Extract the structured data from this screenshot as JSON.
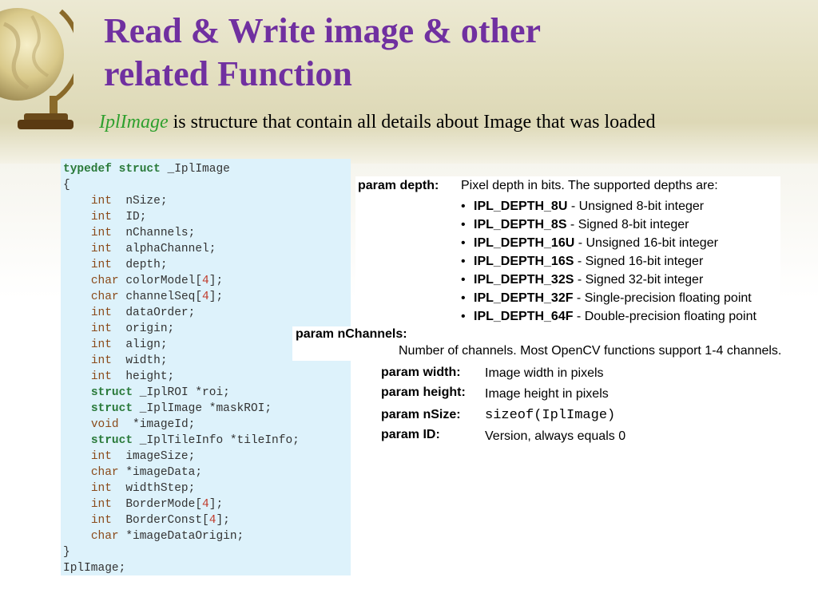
{
  "slide": {
    "title_line1": "Read & Write image & other",
    "title_line2": "related Function",
    "subtitle_keyword": "IplImage",
    "subtitle_rest": " is structure that contain all details about Image that was loaded",
    "colors": {
      "title": "#7030a0",
      "keyword": "#2ea02e",
      "code_bg": "#ddf2fb"
    }
  },
  "code": {
    "lines": [
      [
        {
          "t": "typedef struct",
          "c": "green"
        },
        {
          "t": " _IplImage"
        }
      ],
      [
        {
          "t": "{"
        }
      ],
      [
        {
          "t": "    "
        },
        {
          "t": "int",
          "c": "type"
        },
        {
          "t": "  nSize;"
        }
      ],
      [
        {
          "t": "    "
        },
        {
          "t": "int",
          "c": "type"
        },
        {
          "t": "  ID;"
        }
      ],
      [
        {
          "t": "    "
        },
        {
          "t": "int",
          "c": "type"
        },
        {
          "t": "  nChannels;"
        }
      ],
      [
        {
          "t": "    "
        },
        {
          "t": "int",
          "c": "type"
        },
        {
          "t": "  alphaChannel;"
        }
      ],
      [
        {
          "t": "    "
        },
        {
          "t": "int",
          "c": "type"
        },
        {
          "t": "  depth;"
        }
      ],
      [
        {
          "t": "    "
        },
        {
          "t": "char",
          "c": "type"
        },
        {
          "t": " colorModel["
        },
        {
          "t": "4",
          "c": "num"
        },
        {
          "t": "];"
        }
      ],
      [
        {
          "t": "    "
        },
        {
          "t": "char",
          "c": "type"
        },
        {
          "t": " channelSeq["
        },
        {
          "t": "4",
          "c": "num"
        },
        {
          "t": "];"
        }
      ],
      [
        {
          "t": "    "
        },
        {
          "t": "int",
          "c": "type"
        },
        {
          "t": "  dataOrder;"
        }
      ],
      [
        {
          "t": "    "
        },
        {
          "t": "int",
          "c": "type"
        },
        {
          "t": "  origin;"
        }
      ],
      [
        {
          "t": "    "
        },
        {
          "t": "int",
          "c": "type"
        },
        {
          "t": "  align;"
        }
      ],
      [
        {
          "t": "    "
        },
        {
          "t": "int",
          "c": "type"
        },
        {
          "t": "  width;"
        }
      ],
      [
        {
          "t": "    "
        },
        {
          "t": "int",
          "c": "type"
        },
        {
          "t": "  height;"
        }
      ],
      [
        {
          "t": "    "
        },
        {
          "t": "struct",
          "c": "green"
        },
        {
          "t": " _IplROI *roi;"
        }
      ],
      [
        {
          "t": "    "
        },
        {
          "t": "struct",
          "c": "green"
        },
        {
          "t": " _IplImage *maskROI;"
        }
      ],
      [
        {
          "t": "    "
        },
        {
          "t": "void",
          "c": "type"
        },
        {
          "t": "  *imageId;"
        }
      ],
      [
        {
          "t": "    "
        },
        {
          "t": "struct",
          "c": "green"
        },
        {
          "t": " _IplTileInfo *tileInfo;"
        }
      ],
      [
        {
          "t": "    "
        },
        {
          "t": "int",
          "c": "type"
        },
        {
          "t": "  imageSize;"
        }
      ],
      [
        {
          "t": "    "
        },
        {
          "t": "char",
          "c": "type"
        },
        {
          "t": " *imageData;"
        }
      ],
      [
        {
          "t": "    "
        },
        {
          "t": "int",
          "c": "type"
        },
        {
          "t": "  widthStep;"
        }
      ],
      [
        {
          "t": "    "
        },
        {
          "t": "int",
          "c": "type"
        },
        {
          "t": "  BorderMode["
        },
        {
          "t": "4",
          "c": "num"
        },
        {
          "t": "];"
        }
      ],
      [
        {
          "t": "    "
        },
        {
          "t": "int",
          "c": "type"
        },
        {
          "t": "  BorderConst["
        },
        {
          "t": "4",
          "c": "num"
        },
        {
          "t": "];"
        }
      ],
      [
        {
          "t": "    "
        },
        {
          "t": "char",
          "c": "type"
        },
        {
          "t": " *imageDataOrigin;"
        }
      ],
      [
        {
          "t": "}"
        }
      ],
      [
        {
          "t": "IplImage;"
        }
      ]
    ]
  },
  "params": {
    "depth": {
      "label": "param depth:",
      "intro": "Pixel depth in bits. The supported depths are:",
      "items": [
        {
          "name": "IPL_DEPTH_8U",
          "desc": " - Unsigned 8-bit integer"
        },
        {
          "name": "IPL_DEPTH_8S",
          "desc": " - Signed 8-bit integer"
        },
        {
          "name": "IPL_DEPTH_16U",
          "desc": " - Unsigned 16-bit integer"
        },
        {
          "name": "IPL_DEPTH_16S",
          "desc": " - Signed 16-bit integer"
        },
        {
          "name": "IPL_DEPTH_32S",
          "desc": " - Signed 32-bit integer"
        },
        {
          "name": "IPL_DEPTH_32F",
          "desc": " - Single-precision floating point"
        },
        {
          "name": "IPL_DEPTH_64F",
          "desc": " - Double-precision floating point"
        }
      ]
    },
    "nchannels": {
      "label": "param nChannels:",
      "text": "Number of channels. Most OpenCV functions support 1-4 channels."
    },
    "width": {
      "label": "param width:",
      "text": "Image width in pixels"
    },
    "height": {
      "label": "param height:",
      "text": "Image height in pixels"
    },
    "nsize": {
      "label": "param nSize:",
      "text": "sizeof(IplImage)"
    },
    "id": {
      "label": "param ID:",
      "text": "Version, always equals 0"
    }
  }
}
